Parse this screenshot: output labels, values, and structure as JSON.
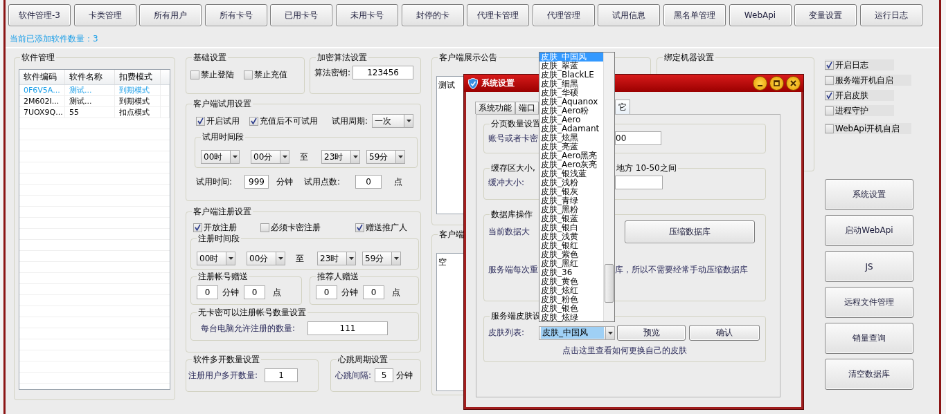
{
  "toolbar": [
    "软件管理-3",
    "卡类管理",
    "所有用户",
    "所有卡号",
    "已用卡号",
    "未用卡号",
    "封停的卡",
    "代理卡管理",
    "代理管理",
    "试用信息",
    "黑名单管理",
    "WebApi",
    "变量设置",
    "运行日志"
  ],
  "software_count": "当前已添加软件数量：3",
  "software_panel": {
    "title": "软件管理",
    "columns": [
      "软件编码",
      "软件名称",
      "扣费模式"
    ],
    "rows": [
      {
        "cells": [
          "0F6V5A...",
          "测试...",
          "到期模式"
        ],
        "selected": true
      },
      {
        "cells": [
          "2M602I...",
          "测试...",
          "到期模式"
        ],
        "selected": false
      },
      {
        "cells": [
          "7UOX9Q...",
          "55",
          "扣点模式"
        ],
        "selected": false
      }
    ]
  },
  "basic_settings": {
    "title": "基础设置",
    "options": [
      {
        "label": "禁止登陆",
        "checked": false
      },
      {
        "label": "禁止充值",
        "checked": false
      }
    ]
  },
  "encryption": {
    "title": "加密算法设置",
    "label": "算法密钥:",
    "value": "123456"
  },
  "trial": {
    "title": "客户端试用设置",
    "options": [
      {
        "label": "开启试用",
        "checked": true
      },
      {
        "label": "充值后不可试用",
        "checked": true
      }
    ],
    "period_label": "试用周期:",
    "period_value": "一次",
    "range": {
      "title": "试用时间段",
      "from": [
        "00时",
        "00分"
      ],
      "to_label": "至",
      "to": [
        "23时",
        "59分"
      ]
    },
    "time_label": "试用时间:",
    "time_value": "999",
    "time_unit": "分钟",
    "points_label": "试用点数:",
    "points_value": "0",
    "points_unit": "点"
  },
  "register": {
    "title": "客户端注册设置",
    "options": [
      {
        "label": "开放注册",
        "checked": true
      },
      {
        "label": "必须卡密注册",
        "checked": false
      },
      {
        "label": "赠送推广人",
        "checked": true
      }
    ],
    "range": {
      "title": "注册时间段",
      "from": [
        "00时",
        "00分"
      ],
      "to_label": "至",
      "to": [
        "23时",
        "59分"
      ]
    },
    "bonuses": [
      {
        "title": "注册帐号赠送",
        "minutes": "0",
        "minutes_unit": "分钟",
        "points": "0",
        "points_unit": "点"
      },
      {
        "title": "推荐人赠送",
        "minutes": "0",
        "minutes_unit": "分钟",
        "points": "0",
        "points_unit": "点"
      }
    ],
    "limit": {
      "title": "无卡密可以注册帐号数量设置",
      "label": "每台电脑允许注册的数量:",
      "value": "111"
    }
  },
  "multi_open": {
    "title": "软件多开数量设置",
    "label": "注册用户多开数量:",
    "value": "1"
  },
  "heartbeat": {
    "title": "心跳周期设置",
    "label": "心跳间隔:",
    "value": "5",
    "unit": "分钟"
  },
  "notice": {
    "title": "客户端展示公告",
    "text": "测试"
  },
  "client_panel": {
    "title": "客户端",
    "text": "空"
  },
  "bind_machine": {
    "title": "绑定机器设置"
  },
  "switches": [
    {
      "label": "开启日志",
      "checked": true
    },
    {
      "label": "服务端开机自启",
      "checked": false
    },
    {
      "label": "开启皮肤",
      "checked": true
    },
    {
      "label": "进程守护",
      "checked": false
    },
    {
      "label": "WebApi开机自启",
      "checked": false
    }
  ],
  "actions": [
    "系统设置",
    "启动WebApi",
    "JS",
    "远程文件管理",
    "销量查询",
    "清空数据库"
  ],
  "dialog": {
    "title": "系统设置",
    "tabs": [
      {
        "label": "系统功能",
        "selected": false
      },
      {
        "label": "端口",
        "selected": false
      },
      {
        "label": "它",
        "selected": true
      }
    ],
    "paging": {
      "title": "分页数量设置",
      "label": "账号或者卡密",
      "value": "00"
    },
    "buffer": {
      "title": "缓存区大小,",
      "note": "地方  10-50之间",
      "label": "缓冲大小:"
    },
    "database": {
      "title": "数据库操作",
      "size_label": "当前数据大",
      "compress_button": "压缩数据库",
      "info_left": "服务端每次重",
      "info_right": "库，所以不需要经常手动压缩数据库"
    },
    "skin": {
      "title": "服务端皮肤设",
      "label": "皮肤列表:",
      "value": "皮肤_中国风",
      "preview_button": "预览",
      "confirm_button": "确认",
      "help_link": "点击这里查看如何更换自己的皮肤"
    }
  },
  "skin_dropdown": {
    "items": [
      {
        "label": "皮肤_中国风",
        "selected": true
      },
      {
        "label": "皮肤_翠蓝",
        "selected": false
      },
      {
        "label": "皮肤_BlackLE",
        "selected": false
      },
      {
        "label": "皮肤_细黑",
        "selected": false
      },
      {
        "label": "皮肤_华硕",
        "selected": false
      },
      {
        "label": "皮肤_Aquanox",
        "selected": false
      },
      {
        "label": "皮肤_Aero粉",
        "selected": false
      },
      {
        "label": "皮肤_Aero",
        "selected": false
      },
      {
        "label": "皮肤_Adamant",
        "selected": false
      },
      {
        "label": "皮肤_炫黑",
        "selected": false
      },
      {
        "label": "皮肤_亮蓝",
        "selected": false
      },
      {
        "label": "皮肤_Aero黑亮",
        "selected": false
      },
      {
        "label": "皮肤_Aero灰亮",
        "selected": false
      },
      {
        "label": "皮肤_银浅蓝",
        "selected": false
      },
      {
        "label": "皮肤_浅粉",
        "selected": false
      },
      {
        "label": "皮肤_银灰",
        "selected": false
      },
      {
        "label": "皮肤_青绿",
        "selected": false
      },
      {
        "label": "皮肤_黑粉",
        "selected": false
      },
      {
        "label": "皮肤_银蓝",
        "selected": false
      },
      {
        "label": "皮肤_银白",
        "selected": false
      },
      {
        "label": "皮肤_浅黄",
        "selected": false
      },
      {
        "label": "皮肤_银红",
        "selected": false
      },
      {
        "label": "皮肤_紫色",
        "selected": false
      },
      {
        "label": "皮肤_黑红",
        "selected": false
      },
      {
        "label": "皮肤_36",
        "selected": false
      },
      {
        "label": "皮肤_黄色",
        "selected": false
      },
      {
        "label": "皮肤_炫红",
        "selected": false
      },
      {
        "label": "皮肤_粉色",
        "selected": false
      },
      {
        "label": "皮肤_银色",
        "selected": false
      },
      {
        "label": "皮肤_炫绿",
        "selected": false
      }
    ]
  }
}
